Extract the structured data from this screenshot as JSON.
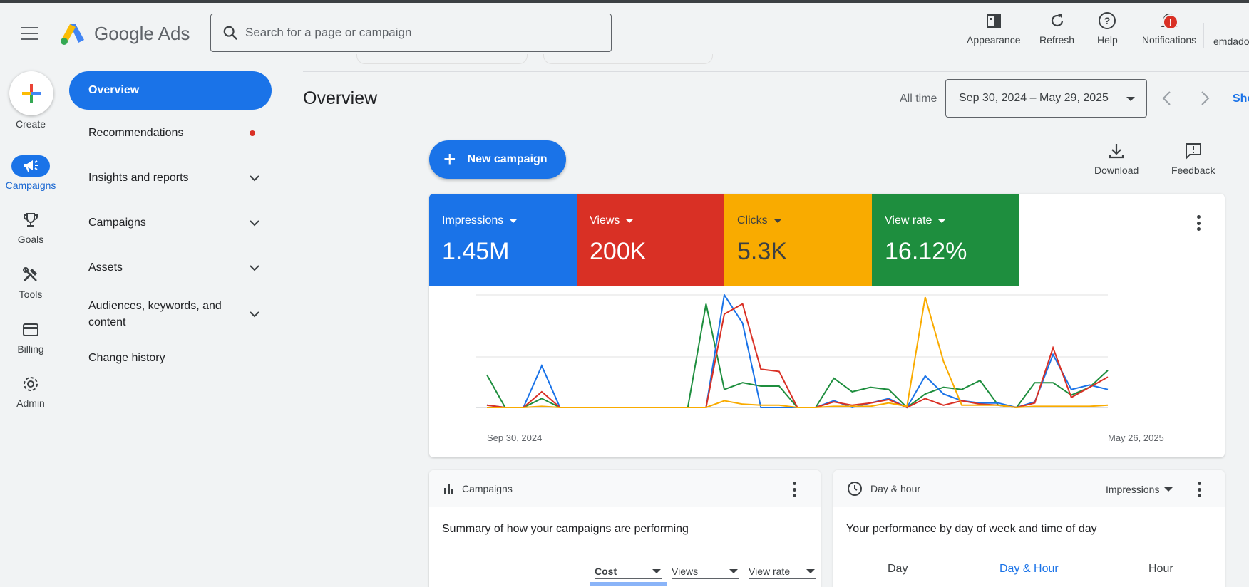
{
  "app": {
    "brand": "Google Ads"
  },
  "search": {
    "placeholder": "Search for a page or campaign"
  },
  "header_actions": [
    {
      "label": "Appearance",
      "icon": "appearance-icon"
    },
    {
      "label": "Refresh",
      "icon": "refresh-icon"
    },
    {
      "label": "Help",
      "icon": "help-icon"
    },
    {
      "label": "Notifications",
      "icon": "bell-icon",
      "badge": "!"
    }
  ],
  "account": {
    "label": "emdado"
  },
  "rail": {
    "create_label": "Create",
    "items": [
      {
        "label": "Campaigns",
        "icon": "megaphone-icon",
        "active": true
      },
      {
        "label": "Goals",
        "icon": "trophy-icon"
      },
      {
        "label": "Tools",
        "icon": "tools-icon"
      },
      {
        "label": "Billing",
        "icon": "credit-card-icon"
      },
      {
        "label": "Admin",
        "icon": "gear-icon"
      }
    ]
  },
  "nav": {
    "active": "Overview",
    "items": [
      {
        "label": "Recommendations"
      },
      {
        "label": "Insights and reports"
      },
      {
        "label": "Campaigns"
      },
      {
        "label": "Assets"
      },
      {
        "label": "Audiences, keywords, and content"
      },
      {
        "label": "Change history"
      }
    ]
  },
  "main": {
    "title": "Overview",
    "date_prefix": "All time",
    "date_range": "Sep 30, 2024 – May 29, 2025",
    "show_link": "Sho",
    "new_campaign": "New campaign",
    "download": "Download",
    "feedback": "Feedback"
  },
  "metrics": [
    {
      "name": "Impressions",
      "value": "1.45M",
      "color": "#1a73e8"
    },
    {
      "name": "Views",
      "value": "200K",
      "color": "#d93025"
    },
    {
      "name": "Clicks",
      "value": "5.3K",
      "color": "#f9ab00"
    },
    {
      "name": "View rate",
      "value": "16.12%",
      "color": "#1e8e3e"
    }
  ],
  "chart": {
    "x_start": "Sep 30, 2024",
    "x_end": "May 26, 2025"
  },
  "chart_data": {
    "type": "line",
    "x_labels": [
      "Sep 30, 2024",
      "May 26, 2025"
    ],
    "grid": true,
    "legend": "none",
    "series": [
      {
        "name": "Impressions",
        "color": "#1a73e8",
        "values": [
          2,
          0,
          0,
          37,
          0,
          0,
          0,
          0,
          0,
          0,
          0,
          0,
          0,
          100,
          75,
          0,
          0,
          0,
          0,
          6,
          0,
          4,
          8,
          0,
          28,
          12,
          6,
          4,
          4,
          0,
          5,
          47,
          16,
          20,
          16
        ]
      },
      {
        "name": "Views",
        "color": "#d93025",
        "values": [
          2,
          0,
          0,
          14,
          0,
          0,
          0,
          0,
          0,
          0,
          0,
          0,
          0,
          83,
          92,
          34,
          32,
          0,
          0,
          5,
          2,
          4,
          7,
          0,
          8,
          2,
          6,
          3,
          2,
          0,
          4,
          53,
          9,
          18,
          27
        ]
      },
      {
        "name": "Clicks",
        "color": "#f9ab00",
        "values": [
          0,
          0,
          0,
          1,
          0,
          0,
          0,
          0,
          0,
          0,
          0,
          0,
          0,
          6,
          3,
          2,
          2,
          0,
          0,
          1,
          1,
          1,
          4,
          1,
          98,
          41,
          2,
          2,
          2,
          0,
          1,
          1,
          1,
          1,
          2
        ]
      },
      {
        "name": "View rate",
        "color": "#1e8e3e",
        "values": [
          29,
          0,
          0,
          8,
          0,
          0,
          0,
          0,
          0,
          0,
          0,
          0,
          92,
          16,
          22,
          19,
          19,
          0,
          0,
          26,
          14,
          18,
          16,
          0,
          12,
          18,
          16,
          24,
          2,
          0,
          22,
          22,
          11,
          18,
          33
        ]
      }
    ]
  },
  "campaigns_card": {
    "header": "Campaigns",
    "subtitle": "Summary of how your campaigns are performing",
    "columns": [
      "Cost",
      "Views",
      "View rate"
    ]
  },
  "dayhour_card": {
    "header": "Day & hour",
    "metric": "Impressions",
    "subtitle": "Your performance by day of week and time of day",
    "tabs": [
      "Day",
      "Day & Hour",
      "Hour"
    ],
    "active_tab": "Day & Hour"
  }
}
